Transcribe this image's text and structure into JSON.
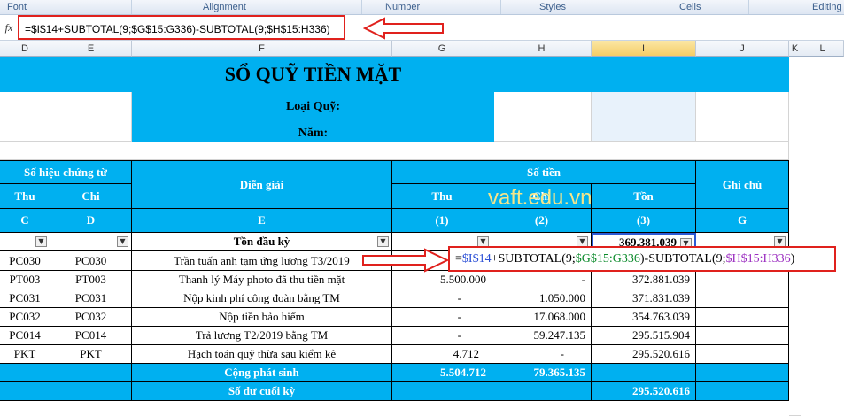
{
  "ribbon": {
    "groups": [
      "Font",
      "Alignment",
      "Number",
      "Styles",
      "Cells",
      "Editing"
    ]
  },
  "formula_bar": {
    "fx_label": "fx",
    "formula": "=$I$14+SUBTOTAL(9;$G$15:G336)-SUBTOTAL(9;$H$15:H336)"
  },
  "columns": [
    "D",
    "E",
    "F",
    "G",
    "H",
    "I",
    "J",
    "K",
    "L"
  ],
  "sheet": {
    "title": "SỔ QUỸ TIỀN MẶT",
    "fund_type_label": "Loại Quỹ:",
    "year_label": "Năm:",
    "headers": {
      "voucher_no": "Số hiệu chứng từ",
      "description": "Diễn giải",
      "amount": "Số tiền",
      "note": "Ghi chú",
      "in": "Thu",
      "out": "Chi",
      "balance": "Tồn",
      "c": "C",
      "d": "D",
      "e": "E",
      "n1": "(1)",
      "n2": "(2)",
      "n3": "(3)",
      "g": "G"
    },
    "opening": {
      "label": "Tồn đầu kỳ",
      "balance": "369.381.039"
    },
    "rows": [
      {
        "thu": "PC030",
        "chi": "PC030",
        "desc": "Trần tuấn anh tạm ứng lương T3/2019",
        "in": "",
        "out": "",
        "bal": ""
      },
      {
        "thu": "PT003",
        "chi": "PT003",
        "desc": "Thanh lý Máy photo đã thu tiền mặt",
        "in": "5.500.000",
        "out": "-",
        "bal": "372.881.039"
      },
      {
        "thu": "PC031",
        "chi": "PC031",
        "desc": "Nộp kinh phí công đoàn bằng TM",
        "in": "-",
        "out": "1.050.000",
        "bal": "371.831.039"
      },
      {
        "thu": "PC032",
        "chi": "PC032",
        "desc": "Nộp tiền bảo hiểm",
        "in": "-",
        "out": "17.068.000",
        "bal": "354.763.039"
      },
      {
        "thu": "PC014",
        "chi": "PC014",
        "desc": "Trả lương T2/2019 bằng TM",
        "in": "-",
        "out": "59.247.135",
        "bal": "295.515.904"
      },
      {
        "thu": "PKT",
        "chi": "PKT",
        "desc": "Hạch toán quỹ thừa sau kiểm kê",
        "in": "4.712",
        "out": "-",
        "bal": "295.520.616"
      }
    ],
    "total": {
      "label": "Cộng phát sinh",
      "in": "5.504.712",
      "out": "79.365.135"
    },
    "closing": {
      "label": "Số dư cuối kỳ",
      "balance": "295.520.616"
    }
  },
  "overlay": {
    "part1": "=$I$14",
    "part2": "+SUBTOTAL(9;",
    "part3": "$G$15:G336",
    "part4": ")-SUBTOTAL(9;",
    "part5": "$H$15:H336",
    "part6": ")"
  },
  "watermark": "vaft.edu.vn",
  "colors": {
    "accent": "#00b0f0",
    "highlight": "#e0211d"
  }
}
